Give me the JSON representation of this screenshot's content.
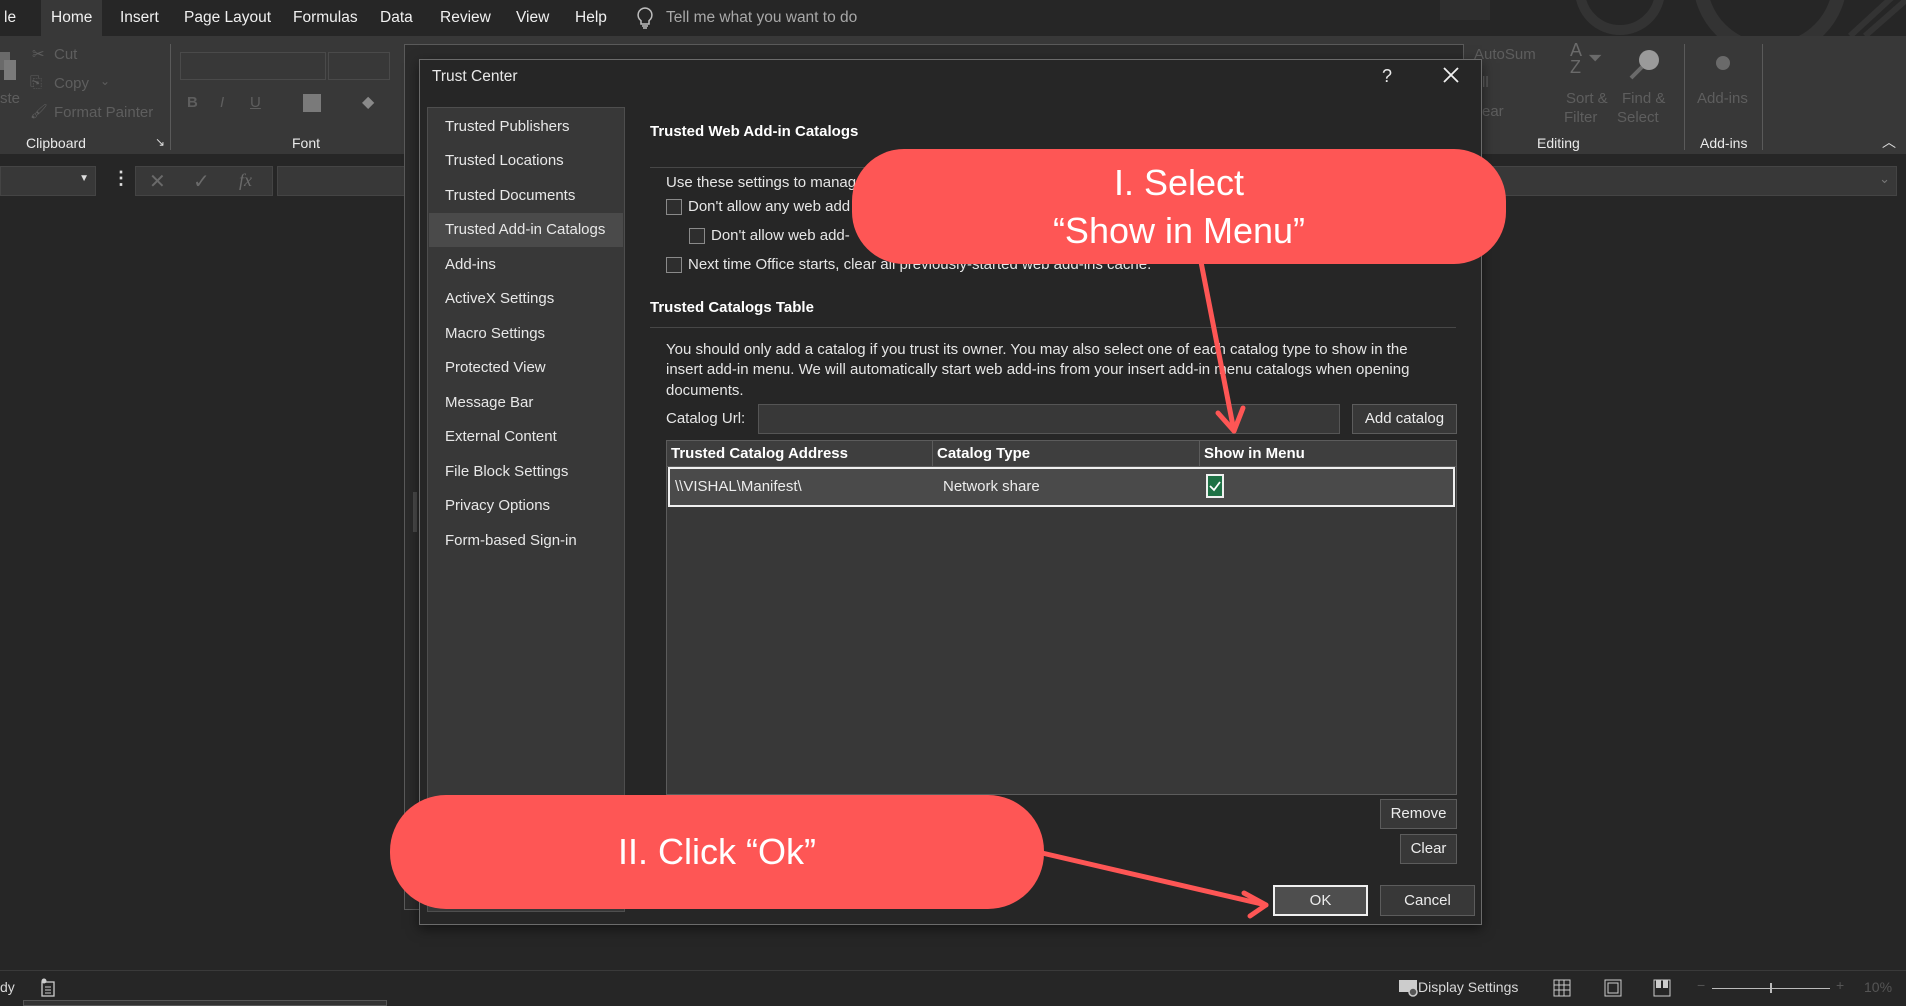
{
  "menu": {
    "tabs": [
      "le",
      "Home",
      "Insert",
      "Page Layout",
      "Formulas",
      "Data",
      "Review",
      "View",
      "Help"
    ],
    "active_tab": "Home",
    "tell_me_placeholder": "Tell me what you want to do"
  },
  "ribbon": {
    "clipboard": {
      "paste_label": "ste",
      "cut_label": "Cut",
      "copy_label": "Copy",
      "format_painter_label": "Format Painter",
      "group_label": "Clipboard"
    },
    "font": {
      "group_label": "Font",
      "bold": "B",
      "italic": "I",
      "underline": "U"
    },
    "editing": {
      "autosum_label": "AutoSum",
      "fill_label": "ll",
      "clear_label": "ear",
      "sort_filter_label_1": "Sort &",
      "sort_filter_label_2": "Filter",
      "find_select_label_1": "Find &",
      "find_select_label_2": "Select",
      "group_label": "Editing"
    },
    "addins": {
      "button_label": "Add-ins",
      "group_label": "Add-ins"
    }
  },
  "formula_bar": {
    "fx_label": "fx"
  },
  "dialog": {
    "title": "Trust Center",
    "help_label": "?",
    "nav_items": [
      "Trusted Publishers",
      "Trusted Locations",
      "Trusted Documents",
      "Trusted Add-in Catalogs",
      "Add-ins",
      "ActiveX Settings",
      "Macro Settings",
      "Protected View",
      "Message Bar",
      "External Content",
      "File Block Settings",
      "Privacy Options",
      "Form-based Sign-in"
    ],
    "selected_nav": "Trusted Add-in Catalogs",
    "web_catalogs": {
      "title": "Trusted Web Add-in Catalogs",
      "intro": "Use these settings to manag",
      "options": [
        {
          "label": "Don't allow any web add",
          "checked": false
        },
        {
          "label": "Don't allow web add-",
          "checked": false
        },
        {
          "label": "Next time Office starts, clear all previously-started web add-ins cache.",
          "checked": false
        }
      ]
    },
    "catalogs_table": {
      "title": "Trusted Catalogs Table",
      "description_1": "You should only add a catalog if you trust its owner. You may also select one of each catalog type to show in the",
      "description_2": "insert add-in menu. We will automatically start web add-ins from your insert add-in menu catalogs when opening",
      "description_3": "documents.",
      "url_label": "Catalog Url:",
      "url_value": "",
      "add_button": "Add catalog",
      "columns": [
        "Trusted Catalog Address",
        "Catalog Type",
        "Show in Menu"
      ],
      "rows": [
        {
          "address": "\\\\VISHAL\\Manifest\\",
          "type": "Network share",
          "show_in_menu": true
        }
      ],
      "remove_button": "Remove",
      "clear_button": "Clear"
    },
    "ok_button": "OK",
    "cancel_button": "Cancel"
  },
  "annotations": {
    "callout1_line1": "I. Select",
    "callout1_line2": "“Show in Menu”",
    "callout2": "II. Click “Ok”",
    "color": "#fe5655"
  },
  "statusbar": {
    "status_text": "dy",
    "display_settings": "Display Settings",
    "zoom_level": "10%"
  }
}
